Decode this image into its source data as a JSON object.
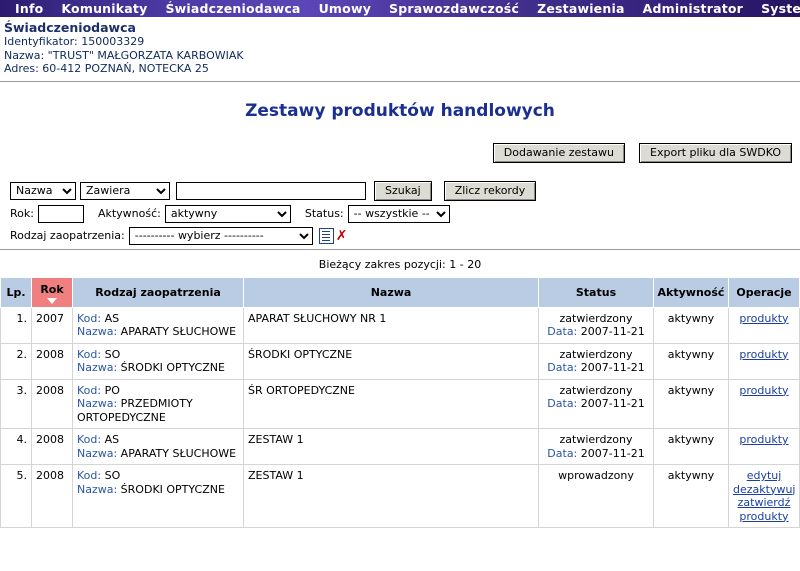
{
  "nav": {
    "items": [
      {
        "label": "Info",
        "name": "nav-info"
      },
      {
        "label": "Komunikaty",
        "name": "nav-komunikaty"
      },
      {
        "label": "Świadczeniodawca",
        "name": "nav-swiadczeniodawca"
      },
      {
        "label": "Umowy",
        "name": "nav-umowy"
      },
      {
        "label": "Sprawozdawczość",
        "name": "nav-sprawozdawczosc"
      },
      {
        "label": "Zestawienia",
        "name": "nav-zestawienia"
      },
      {
        "label": "Administrator",
        "name": "nav-administrator"
      },
      {
        "label": "System",
        "name": "nav-system"
      }
    ]
  },
  "provider": {
    "title": "Świadczeniodawca",
    "identyfikator": "Identyfikator: 150003329",
    "nazwa": "Nazwa: \"TRUST\" MAŁGORZATA KARBOWIAK",
    "adres": "Adres: 60-412 POZNAŃ, NOTECKA 25"
  },
  "page": {
    "title": "Zestawy produktów handlowych"
  },
  "actions": {
    "add_label": "Dodawanie zestawu",
    "export_label": "Export pliku dla SWDKO"
  },
  "filters": {
    "field_select": "Nazwa",
    "operator_select": "Zawiera",
    "search_value": "",
    "search_placeholder": "",
    "search_button": "Szukaj",
    "count_button": "Zlicz rekordy",
    "rok_label": "Rok:",
    "rok_value": "",
    "aktywnosc_label": "Aktywność:",
    "aktywnosc_value": "aktywny",
    "status_label": "Status:",
    "status_value": "-- wszystkie --",
    "rodzaj_label": "Rodzaj zaopatrzenia:",
    "rodzaj_value": "---------- wybierz ----------",
    "list_icon": "list-icon",
    "clear_icon": "✗"
  },
  "results": {
    "range_text": "Bieżący zakres pozycji: 1 - 20",
    "headers": {
      "lp": "Lp.",
      "rok": "Rok",
      "rodzaj": "Rodzaj zaopatrzenia",
      "nazwa": "Nazwa",
      "status": "Status",
      "aktywnosc": "Aktywność",
      "operacje": "Operacje"
    },
    "sorted_column": "rok",
    "sort_direction": "desc",
    "rows": [
      {
        "lp": "1.",
        "rok": "2007",
        "kod_label": "Kod:",
        "kod_value": "AS",
        "nazwa_label": "Nazwa:",
        "nazwa_value": "APARATY SŁUCHOWE",
        "nazwa": "APARAT SŁUCHOWY NR 1",
        "status": "zatwierdzony",
        "data_label": "Data:",
        "data_value": "2007-11-21",
        "aktywnosc": "aktywny",
        "operacje": [
          "produkty"
        ]
      },
      {
        "lp": "2.",
        "rok": "2008",
        "kod_label": "Kod:",
        "kod_value": "SO",
        "nazwa_label": "Nazwa:",
        "nazwa_value": "ŚRODKI OPTYCZNE",
        "nazwa": "ŚRODKI OPTYCZNE",
        "status": "zatwierdzony",
        "data_label": "Data:",
        "data_value": "2007-11-21",
        "aktywnosc": "aktywny",
        "operacje": [
          "produkty"
        ]
      },
      {
        "lp": "3.",
        "rok": "2008",
        "kod_label": "Kod:",
        "kod_value": "PO",
        "nazwa_label": "Nazwa:",
        "nazwa_value": "PRZEDMIOTY ORTOPEDYCZNE",
        "nazwa": "ŚR ORTOPEDYCZNE",
        "status": "zatwierdzony",
        "data_label": "Data:",
        "data_value": "2007-11-21",
        "aktywnosc": "aktywny",
        "operacje": [
          "produkty"
        ]
      },
      {
        "lp": "4.",
        "rok": "2008",
        "kod_label": "Kod:",
        "kod_value": "AS",
        "nazwa_label": "Nazwa:",
        "nazwa_value": "APARATY SŁUCHOWE",
        "nazwa": "ZESTAW 1",
        "status": "zatwierdzony",
        "data_label": "Data:",
        "data_value": "2007-11-21",
        "aktywnosc": "aktywny",
        "operacje": [
          "produkty"
        ]
      },
      {
        "lp": "5.",
        "rok": "2008",
        "kod_label": "Kod:",
        "kod_value": "SO",
        "nazwa_label": "Nazwa:",
        "nazwa_value": "ŚRODKI OPTYCZNE",
        "nazwa": "ZESTAW 1",
        "status": "wprowadzony",
        "data_label": "",
        "data_value": "",
        "aktywnosc": "aktywny",
        "operacje": [
          "edytuj",
          "dezaktywuj",
          "zatwierdź",
          "produkty"
        ]
      }
    ]
  },
  "colors": {
    "nav_purple": "#4a3699",
    "header_blue": "#b9cce4",
    "sorted_pink": "#f08080",
    "title_blue": "#1a2f8f",
    "link_blue": "#1a3fa0"
  }
}
